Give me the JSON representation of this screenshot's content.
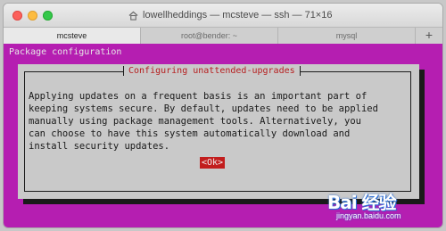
{
  "window": {
    "title": "lowellheddings — mcsteve — ssh — 71×16"
  },
  "tabs": [
    {
      "label": "mcsteve",
      "active": true
    },
    {
      "label": "root@bender: ~",
      "active": false
    },
    {
      "label": "mysql",
      "active": false
    }
  ],
  "tabbar": {
    "add_label": "+"
  },
  "terminal": {
    "background": "#b51eb1",
    "header": "Package configuration",
    "dialog": {
      "title": "Configuring unattended-upgrades",
      "lines": [
        "Applying updates on a frequent basis is an important part of",
        "keeping systems secure. By default, updates need to be applied",
        "manually using package management tools. Alternatively, you",
        "can choose to have this system automatically download and",
        "install security updates."
      ],
      "ok_label": "<Ok>"
    }
  },
  "watermark": {
    "logo": "Bai 经验",
    "url": "jingyan.baidu.com"
  }
}
